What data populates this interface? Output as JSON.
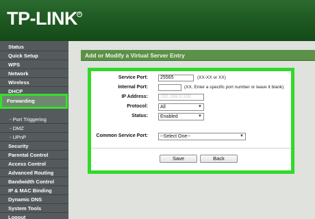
{
  "header": {
    "logo": "TP-LINK",
    "trademark": "®"
  },
  "sidebar": {
    "items": [
      {
        "label": "Status"
      },
      {
        "label": "Quick Setup"
      },
      {
        "label": "WPS"
      },
      {
        "label": "Network"
      },
      {
        "label": "Wireless"
      },
      {
        "label": "DHCP"
      },
      {
        "label": "Forwarding"
      },
      {
        "label": "- Port Triggering"
      },
      {
        "label": "- DMZ"
      },
      {
        "label": "- UPnP"
      },
      {
        "label": "Security"
      },
      {
        "label": "Parental Control"
      },
      {
        "label": "Access Control"
      },
      {
        "label": "Advanced Routing"
      },
      {
        "label": "Bandwidth Control"
      },
      {
        "label": "IP & MAC Binding"
      },
      {
        "label": "Dynamic DNS"
      },
      {
        "label": "System Tools"
      },
      {
        "label": "Logout"
      }
    ]
  },
  "page": {
    "title": "Add or Modify a Virtual Server Entry"
  },
  "form": {
    "service_port": {
      "label": "Service Port:",
      "value": "25565",
      "hint": "(XX-XX or XX)"
    },
    "internal_port": {
      "label": "Internal Port:",
      "value": "",
      "hint": "(XX, Enter a specific port number or leave it blank)"
    },
    "ip_address": {
      "label": "IP Address:",
      "value": "192.168.0.100"
    },
    "protocol": {
      "label": "Protocol:",
      "value": "All"
    },
    "status": {
      "label": "Status:",
      "value": "Enabled"
    },
    "common_service_port": {
      "label": "Common Service Port:",
      "value": "--Select One--"
    },
    "save_label": "Save",
    "back_label": "Back"
  },
  "colors": {
    "highlight": "#32d92a",
    "brand": "#1e5a22",
    "title_bar": "#5c9148"
  }
}
